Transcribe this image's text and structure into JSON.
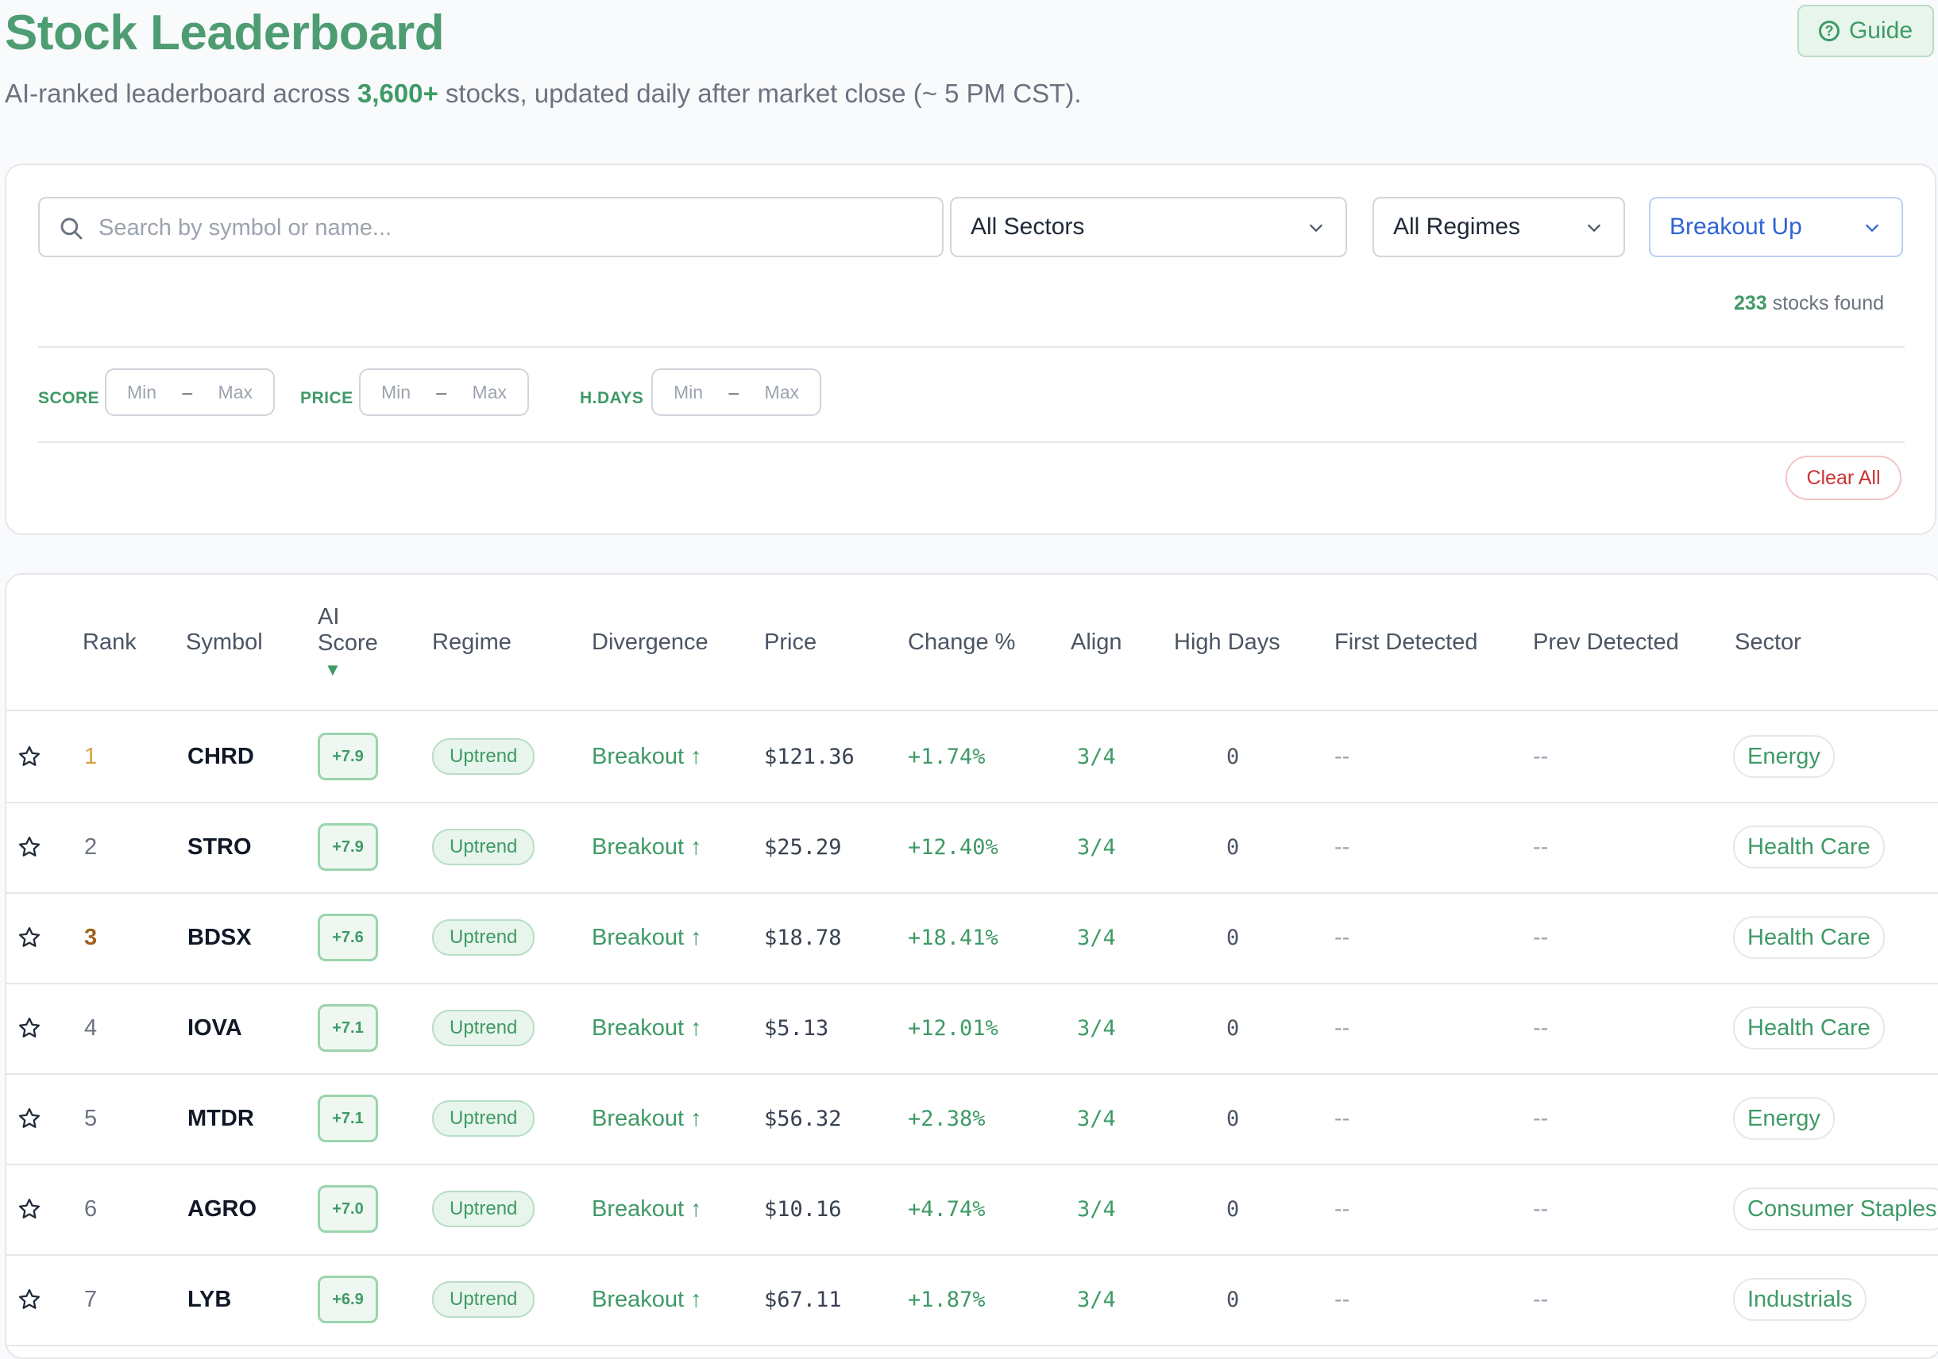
{
  "header": {
    "title": "Stock Leaderboard",
    "subtitle_before": "AI-ranked leaderboard across ",
    "subtitle_highlight": "3,600+",
    "subtitle_after": " stocks, updated daily after market close (~ 5 PM CST).",
    "guide_label": "Guide"
  },
  "filters": {
    "search_placeholder": "Search by symbol or name...",
    "sector_select": "All Sectors",
    "regime_select": "All Regimes",
    "signal_select": "Breakout Up",
    "found_count": "233",
    "found_suffix": "stocks found",
    "score_label": "SCORE",
    "price_label": "PRICE",
    "hdays_label": "H.DAYS",
    "min_placeholder": "Min",
    "max_placeholder": "Max",
    "range_separator": "–",
    "clear_label": "Clear All"
  },
  "table": {
    "headers": {
      "rank": "Rank",
      "symbol": "Symbol",
      "score_line1": "AI",
      "score_line2": "Score",
      "sort_arrow": "▼",
      "regime": "Regime",
      "divergence": "Divergence",
      "price": "Price",
      "change": "Change %",
      "align": "Align",
      "high_days": "High Days",
      "first_detected": "First Detected",
      "prev_detected": "Prev Detected",
      "sector": "Sector"
    },
    "rows": [
      {
        "rank": "1",
        "symbol": "CHRD",
        "score": "+7.9",
        "regime": "Uptrend",
        "divergence": "Breakout ↑",
        "price": "$121.36",
        "change": "+1.74%",
        "align": "3/4",
        "high_days": "0",
        "first": "--",
        "prev": "--",
        "sector": "Energy"
      },
      {
        "rank": "2",
        "symbol": "STRO",
        "score": "+7.9",
        "regime": "Uptrend",
        "divergence": "Breakout ↑",
        "price": "$25.29",
        "change": "+12.40%",
        "align": "3/4",
        "high_days": "0",
        "first": "--",
        "prev": "--",
        "sector": "Health Care"
      },
      {
        "rank": "3",
        "symbol": "BDSX",
        "score": "+7.6",
        "regime": "Uptrend",
        "divergence": "Breakout ↑",
        "price": "$18.78",
        "change": "+18.41%",
        "align": "3/4",
        "high_days": "0",
        "first": "--",
        "prev": "--",
        "sector": "Health Care"
      },
      {
        "rank": "4",
        "symbol": "IOVA",
        "score": "+7.1",
        "regime": "Uptrend",
        "divergence": "Breakout ↑",
        "price": "$5.13",
        "change": "+12.01%",
        "align": "3/4",
        "high_days": "0",
        "first": "--",
        "prev": "--",
        "sector": "Health Care"
      },
      {
        "rank": "5",
        "symbol": "MTDR",
        "score": "+7.1",
        "regime": "Uptrend",
        "divergence": "Breakout ↑",
        "price": "$56.32",
        "change": "+2.38%",
        "align": "3/4",
        "high_days": "0",
        "first": "--",
        "prev": "--",
        "sector": "Energy"
      },
      {
        "rank": "6",
        "symbol": "AGRO",
        "score": "+7.0",
        "regime": "Uptrend",
        "divergence": "Breakout ↑",
        "price": "$10.16",
        "change": "+4.74%",
        "align": "3/4",
        "high_days": "0",
        "first": "--",
        "prev": "--",
        "sector": "Consumer Staples"
      },
      {
        "rank": "7",
        "symbol": "LYB",
        "score": "+6.9",
        "regime": "Uptrend",
        "divergence": "Breakout ↑",
        "price": "$67.11",
        "change": "+1.87%",
        "align": "3/4",
        "high_days": "0",
        "first": "--",
        "prev": "--",
        "sector": "Industrials"
      }
    ]
  },
  "colors": {
    "accent_green": "#3f9a66",
    "title_green": "#4e9d72",
    "select_blue": "#2f63d6",
    "clear_red": "#cc3333",
    "rank_gold": "#d4a340",
    "rank_bronze": "#a0621e"
  },
  "icons": {
    "guide": "question-circle-icon",
    "search": "search-icon",
    "dropdown": "chevron-down-icon",
    "favorite": "star-outline-icon"
  }
}
